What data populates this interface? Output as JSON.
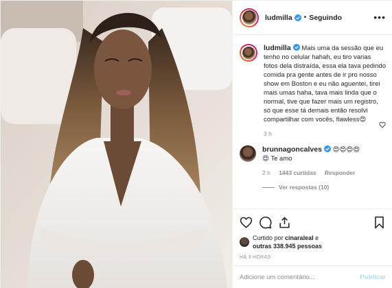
{
  "post": {
    "author": "ludmilla",
    "follow_state": "Seguindo",
    "dot": "•",
    "more": "•••"
  },
  "caption": {
    "username": "ludmilla",
    "text": "Mais uma da sessão que eu tenho no celular hahah, eu tiro varias fotos dela distraída, essa ela tava pedindo comida pra gente antes de ir pro nosso show em Boston e eu não aguentei, tirei mais umas haha, tava mais linda que o normal, tive que fazer mais um registro, só que esse tá demais então resolvi compartilhar com vocês, flawless😍",
    "time": "3 h"
  },
  "comment": {
    "username": "brunnagoncalves",
    "emojis": "😍😍😍😍",
    "text": "😍 Te amo",
    "time": "2 h",
    "likes": "1443 curtidas",
    "reply": "Responder",
    "view_replies": "Ver respostas (10)"
  },
  "likes": {
    "prefix": "Curtido por",
    "user": "cinaraleal",
    "connector": "e",
    "others": "outras 338.945 pessoas"
  },
  "timestamp": "HÁ 3 HORAS",
  "composer": {
    "placeholder": "Adicione um comentário...",
    "publish": "Publicar"
  },
  "colors": {
    "verified": "#3897f0",
    "text": "#262626",
    "secondary": "#8e8e8e",
    "publish_disabled": "#b2dffc"
  }
}
